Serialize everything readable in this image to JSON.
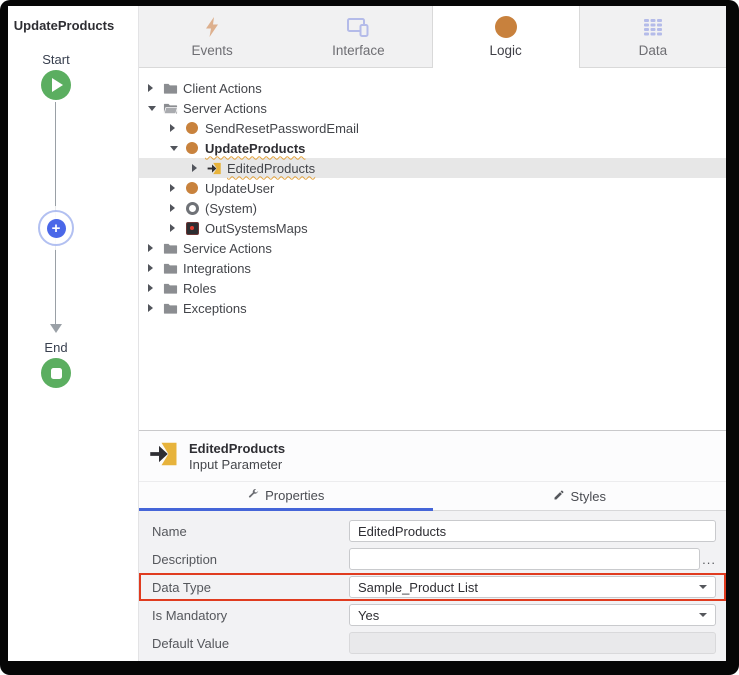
{
  "flow": {
    "title": "UpdateProducts",
    "start_label": "Start",
    "end_label": "End",
    "plus_glyph": "+"
  },
  "tabs": [
    {
      "label": "Events",
      "icon": "lightning-icon",
      "selected": false
    },
    {
      "label": "Interface",
      "icon": "devices-icon",
      "selected": false
    },
    {
      "label": "Logic",
      "icon": "circle-icon",
      "selected": true
    },
    {
      "label": "Data",
      "icon": "grid-icon",
      "selected": false
    }
  ],
  "tree": {
    "items": [
      {
        "label": "Client Actions",
        "icon": "folder-icon",
        "level": 0,
        "state": "collapsed",
        "selected": false,
        "bold": false,
        "warning": false
      },
      {
        "label": "Server Actions",
        "icon": "folder-open-icon",
        "level": 0,
        "state": "expanded",
        "selected": false,
        "bold": false,
        "warning": false
      },
      {
        "label": "SendResetPasswordEmail",
        "icon": "action-icon",
        "level": 1,
        "state": "collapsed",
        "selected": false,
        "bold": false,
        "warning": false
      },
      {
        "label": "UpdateProducts",
        "icon": "action-icon",
        "level": 1,
        "state": "expanded",
        "selected": false,
        "bold": true,
        "warning": true
      },
      {
        "label": "EditedProducts",
        "icon": "input-parameter-icon",
        "level": 2,
        "state": "collapsed",
        "selected": true,
        "bold": false,
        "warning": true
      },
      {
        "label": "UpdateUser",
        "icon": "action-icon",
        "level": 1,
        "state": "collapsed",
        "selected": false,
        "bold": false,
        "warning": false
      },
      {
        "label": "(System)",
        "icon": "system-icon",
        "level": 1,
        "state": "collapsed",
        "selected": false,
        "bold": false,
        "warning": false
      },
      {
        "label": "OutSystemsMaps",
        "icon": "maps-icon",
        "level": 1,
        "state": "collapsed",
        "selected": false,
        "bold": false,
        "warning": false
      },
      {
        "label": "Service Actions",
        "icon": "folder-icon",
        "level": 0,
        "state": "collapsed",
        "selected": false,
        "bold": false,
        "warning": false
      },
      {
        "label": "Integrations",
        "icon": "folder-icon",
        "level": 0,
        "state": "collapsed",
        "selected": false,
        "bold": false,
        "warning": false
      },
      {
        "label": "Roles",
        "icon": "folder-icon",
        "level": 0,
        "state": "collapsed",
        "selected": false,
        "bold": false,
        "warning": false
      },
      {
        "label": "Exceptions",
        "icon": "folder-icon",
        "level": 0,
        "state": "collapsed",
        "selected": false,
        "bold": false,
        "warning": false
      }
    ]
  },
  "detail": {
    "title": "EditedProducts",
    "subtitle": "Input Parameter",
    "tabs": [
      {
        "label": "Properties",
        "icon": "wrench-icon",
        "selected": true
      },
      {
        "label": "Styles",
        "icon": "pencil-icon",
        "selected": false
      }
    ],
    "properties": [
      {
        "label": "Name",
        "value": "EditedProducts",
        "control": "text",
        "highlighted": false
      },
      {
        "label": "Description",
        "value": "",
        "suffix": "...",
        "control": "text",
        "highlighted": false
      },
      {
        "label": "Data Type",
        "value": "Sample_Product List",
        "control": "select",
        "highlighted": true
      },
      {
        "label": "Is Mandatory",
        "value": "Yes",
        "control": "select",
        "highlighted": false
      },
      {
        "label": "Default Value",
        "value": "",
        "control": "disabled",
        "highlighted": false
      }
    ]
  },
  "colors": {
    "accent_blue": "#4565d8",
    "plus_blue": "#4a67e8",
    "node_green": "#5bae60",
    "action_orange": "#c8813d",
    "highlight_red": "#e03b1f",
    "warning_wave_orange": "#e2a23c",
    "selected_row_gray": "#e7e7e7",
    "tab_bar_gray": "#f1f1f2",
    "props_bg_gray": "#f2f2f4"
  }
}
